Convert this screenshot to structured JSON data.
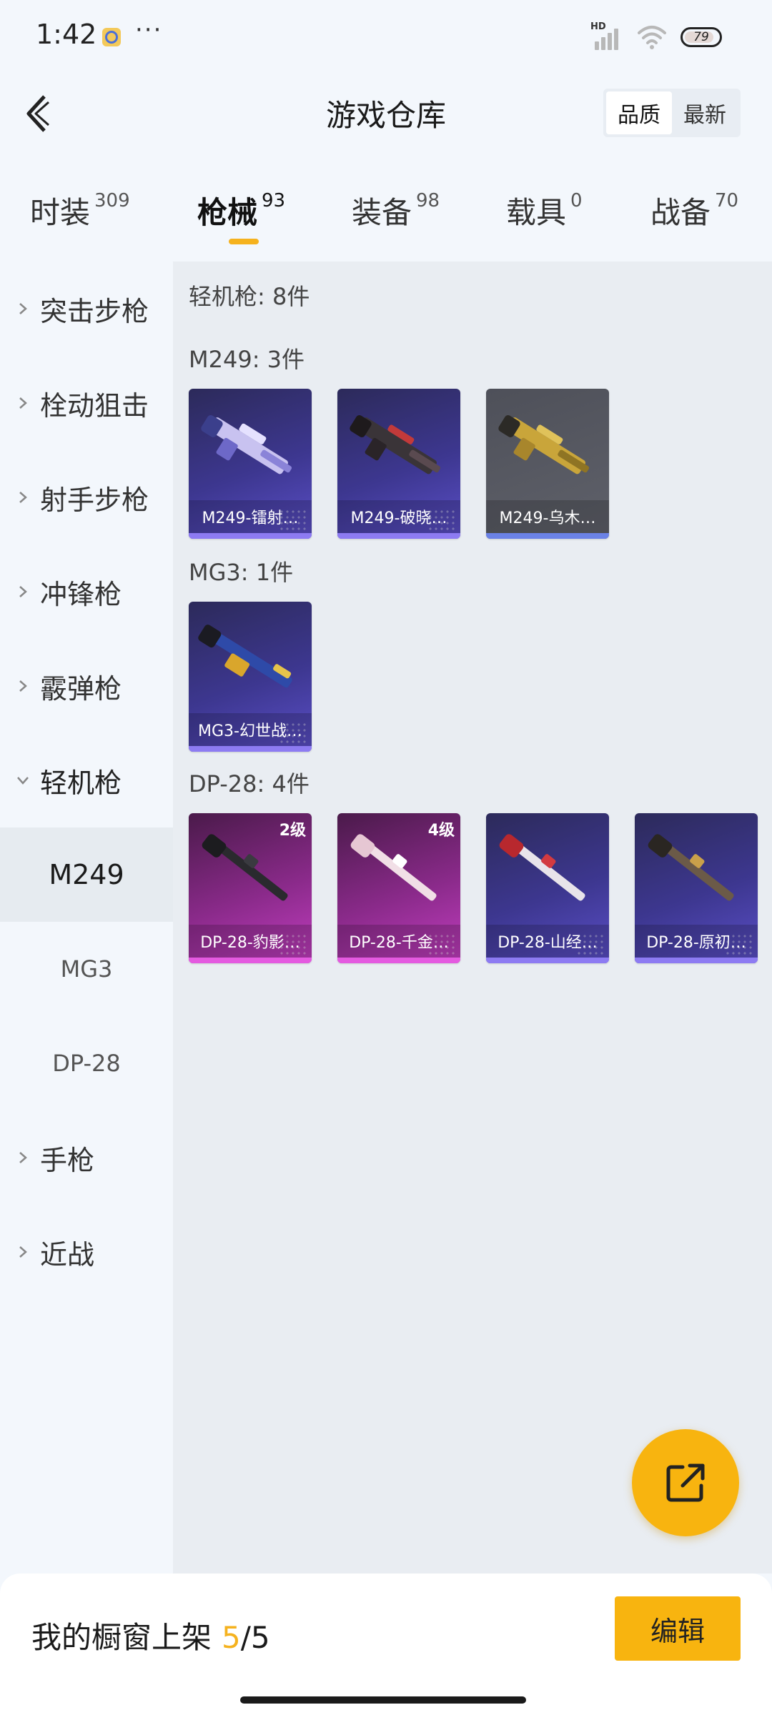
{
  "status_bar": {
    "time": "1:42",
    "more": "···",
    "network_badge": "HD",
    "battery": "79"
  },
  "header": {
    "title": "游戏仓库",
    "sort_options": [
      "品质",
      "最新"
    ],
    "active_sort": "品质"
  },
  "tabs": [
    {
      "label": "时装",
      "count": "309"
    },
    {
      "label": "枪械",
      "count": "93"
    },
    {
      "label": "装备",
      "count": "98"
    },
    {
      "label": "载具",
      "count": "0"
    },
    {
      "label": "战备",
      "count": "70"
    }
  ],
  "active_tab": "枪械",
  "sidebar": {
    "categories": [
      "突击步枪",
      "栓动狙击",
      "射手步枪",
      "冲锋枪",
      "霰弹枪",
      "轻机枪",
      "手枪",
      "近战"
    ],
    "expanded_category": "轻机枪",
    "subcategories": [
      "M249",
      "MG3",
      "DP-28"
    ],
    "active_subcategory": "M249"
  },
  "content": {
    "heading": "轻机枪: 8件",
    "groups": [
      {
        "title": "M249: 3件",
        "items": [
          {
            "label": "M249-镭射…",
            "quality": "purple",
            "level": ""
          },
          {
            "label": "M249-破晓…",
            "quality": "purple",
            "level": ""
          },
          {
            "label": "M249-乌木…",
            "quality": "gray",
            "level": ""
          }
        ]
      },
      {
        "title": "MG3: 1件",
        "items": [
          {
            "label": "MG3-幻世战…",
            "quality": "purple",
            "level": ""
          }
        ]
      },
      {
        "title": "DP-28: 4件",
        "items": [
          {
            "label": "DP-28-豹影…",
            "quality": "pink",
            "level": "2级"
          },
          {
            "label": "DP-28-千金…",
            "quality": "pink",
            "level": "4级"
          },
          {
            "label": "DP-28-山经…",
            "quality": "purple",
            "level": ""
          },
          {
            "label": "DP-28-原初…",
            "quality": "purple",
            "level": ""
          }
        ]
      }
    ]
  },
  "bottom_bar": {
    "showcase_label": "我的橱窗上架",
    "showcase_used": "5",
    "showcase_total": "/5",
    "edit_label": "编辑"
  },
  "colors": {
    "accent": "#f8b40f",
    "purple_quality": "#5b4fc8",
    "pink_quality": "#c23ec0",
    "gray_quality": "#5f616a"
  },
  "icons": {
    "back": "chevron-left-icon",
    "share": "external-share-icon",
    "expand": "chevron-right-icon",
    "collapse": "chevron-down-icon"
  }
}
